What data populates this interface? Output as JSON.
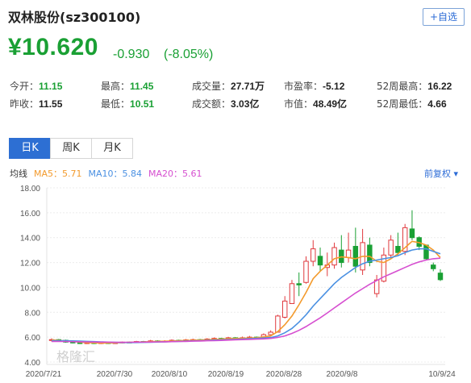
{
  "header": {
    "title": "双林股份(sz300100)",
    "watch_button": "+自选",
    "price": "¥10.620",
    "change": "-0.930",
    "change_pct": "(-8.05%)"
  },
  "stats": [
    {
      "label": "今开：",
      "value": "11.15",
      "tone": "green"
    },
    {
      "label": "最高：",
      "value": "11.45",
      "tone": "green"
    },
    {
      "label": "成交量：",
      "value": "27.71万",
      "tone": "dark"
    },
    {
      "label": "市盈率：",
      "value": "-5.12",
      "tone": "dark"
    },
    {
      "label": "52周最高：",
      "value": "16.22",
      "tone": "dark"
    },
    {
      "label": "昨收：",
      "value": "11.55",
      "tone": "dark"
    },
    {
      "label": "最低：",
      "value": "10.51",
      "tone": "green"
    },
    {
      "label": "成交额：",
      "value": "3.03亿",
      "tone": "dark"
    },
    {
      "label": "市值：",
      "value": "48.49亿",
      "tone": "dark"
    },
    {
      "label": "52周最低：",
      "value": "4.66",
      "tone": "dark"
    }
  ],
  "tabs": [
    "日K",
    "周K",
    "月K"
  ],
  "active_tab": 0,
  "ma_legend": {
    "label": "均线",
    "items": [
      {
        "text": "MA5：5.71",
        "color": "#f39a2c"
      },
      {
        "text": "MA10：5.84",
        "color": "#4a90e2"
      },
      {
        "text": "MA20：5.61",
        "color": "#d64fd0"
      }
    ]
  },
  "adjust_button": "前复权 ▾",
  "watermark": "格隆汇",
  "chart_data": {
    "type": "candlestick",
    "ylim": [
      4,
      18
    ],
    "y_ticks": [
      "18.00",
      "16.00",
      "14.00",
      "12.00",
      "10.00",
      "8.00",
      "6.00",
      "4.00"
    ],
    "x_ticks": [
      "2020/7/21",
      "2020/7/30",
      "2020/8/10",
      "2020/8/19",
      "2020/8/28",
      "2020/9/8",
      "10/9/24"
    ],
    "colors": {
      "up": "#e0393e",
      "down": "#1aa034",
      "ma5": "#f39a2c",
      "ma10": "#4a90e2",
      "ma20": "#d64fd0"
    },
    "candles": [
      {
        "o": 5.75,
        "c": 5.8,
        "h": 5.9,
        "l": 5.65
      },
      {
        "o": 5.8,
        "c": 5.75,
        "h": 5.85,
        "l": 5.7
      },
      {
        "o": 5.75,
        "c": 5.6,
        "h": 5.8,
        "l": 5.55
      },
      {
        "o": 5.6,
        "c": 5.55,
        "h": 5.65,
        "l": 5.5
      },
      {
        "o": 5.55,
        "c": 5.5,
        "h": 5.6,
        "l": 5.45
      },
      {
        "o": 5.5,
        "c": 5.55,
        "h": 5.6,
        "l": 5.45
      },
      {
        "o": 5.55,
        "c": 5.5,
        "h": 5.6,
        "l": 5.45
      },
      {
        "o": 5.5,
        "c": 5.55,
        "h": 5.6,
        "l": 5.45
      },
      {
        "o": 5.55,
        "c": 5.5,
        "h": 5.58,
        "l": 5.45
      },
      {
        "o": 5.5,
        "c": 5.55,
        "h": 5.6,
        "l": 5.48
      },
      {
        "o": 5.55,
        "c": 5.6,
        "h": 5.65,
        "l": 5.5
      },
      {
        "o": 5.6,
        "c": 5.58,
        "h": 5.65,
        "l": 5.52
      },
      {
        "o": 5.58,
        "c": 5.65,
        "h": 5.7,
        "l": 5.55
      },
      {
        "o": 5.65,
        "c": 5.6,
        "h": 5.7,
        "l": 5.55
      },
      {
        "o": 5.6,
        "c": 5.7,
        "h": 5.78,
        "l": 5.58
      },
      {
        "o": 5.7,
        "c": 5.65,
        "h": 5.75,
        "l": 5.6
      },
      {
        "o": 5.65,
        "c": 5.68,
        "h": 5.75,
        "l": 5.6
      },
      {
        "o": 5.68,
        "c": 5.75,
        "h": 5.82,
        "l": 5.62
      },
      {
        "o": 5.75,
        "c": 5.7,
        "h": 5.8,
        "l": 5.65
      },
      {
        "o": 5.7,
        "c": 5.78,
        "h": 5.85,
        "l": 5.66
      },
      {
        "o": 5.78,
        "c": 5.8,
        "h": 5.88,
        "l": 5.72
      },
      {
        "o": 5.8,
        "c": 5.75,
        "h": 5.86,
        "l": 5.7
      },
      {
        "o": 5.75,
        "c": 5.85,
        "h": 5.92,
        "l": 5.72
      },
      {
        "o": 5.85,
        "c": 5.9,
        "h": 5.98,
        "l": 5.8
      },
      {
        "o": 5.9,
        "c": 5.85,
        "h": 5.95,
        "l": 5.8
      },
      {
        "o": 5.85,
        "c": 5.95,
        "h": 6.02,
        "l": 5.82
      },
      {
        "o": 5.95,
        "c": 5.9,
        "h": 6.0,
        "l": 5.85
      },
      {
        "o": 5.9,
        "c": 5.95,
        "h": 6.05,
        "l": 5.86
      },
      {
        "o": 5.95,
        "c": 6.0,
        "h": 6.1,
        "l": 5.9
      },
      {
        "o": 6.0,
        "c": 5.95,
        "h": 6.05,
        "l": 5.9
      },
      {
        "o": 5.95,
        "c": 6.2,
        "h": 6.3,
        "l": 5.92
      },
      {
        "o": 6.2,
        "c": 6.4,
        "h": 6.55,
        "l": 6.15
      },
      {
        "o": 6.4,
        "c": 7.7,
        "h": 7.8,
        "l": 6.4
      },
      {
        "o": 7.6,
        "c": 8.9,
        "h": 9.3,
        "l": 7.5
      },
      {
        "o": 8.7,
        "c": 10.3,
        "h": 10.6,
        "l": 8.7
      },
      {
        "o": 10.3,
        "c": 10.2,
        "h": 11.2,
        "l": 9.3
      },
      {
        "o": 10.4,
        "c": 12.1,
        "h": 12.5,
        "l": 10.3
      },
      {
        "o": 12.1,
        "c": 13.1,
        "h": 13.8,
        "l": 11.7
      },
      {
        "o": 12.5,
        "c": 11.8,
        "h": 13.2,
        "l": 11.3
      },
      {
        "o": 11.6,
        "c": 11.8,
        "h": 12.8,
        "l": 10.9
      },
      {
        "o": 11.8,
        "c": 13.2,
        "h": 13.6,
        "l": 11.5
      },
      {
        "o": 13.0,
        "c": 12.0,
        "h": 14.2,
        "l": 11.6
      },
      {
        "o": 12.4,
        "c": 13.0,
        "h": 14.4,
        "l": 12.0
      },
      {
        "o": 13.3,
        "c": 11.7,
        "h": 14.8,
        "l": 11.2
      },
      {
        "o": 11.4,
        "c": 13.6,
        "h": 14.7,
        "l": 11.0
      },
      {
        "o": 13.4,
        "c": 12.0,
        "h": 14.0,
        "l": 11.7
      },
      {
        "o": 9.5,
        "c": 10.6,
        "h": 11.0,
        "l": 9.2
      },
      {
        "o": 10.5,
        "c": 12.6,
        "h": 13.2,
        "l": 10.4
      },
      {
        "o": 12.6,
        "c": 13.8,
        "h": 14.2,
        "l": 12.4
      },
      {
        "o": 13.3,
        "c": 12.8,
        "h": 14.4,
        "l": 12.6
      },
      {
        "o": 12.9,
        "c": 14.8,
        "h": 15.1,
        "l": 12.6
      },
      {
        "o": 14.7,
        "c": 14.0,
        "h": 16.2,
        "l": 13.8
      },
      {
        "o": 14.0,
        "c": 13.3,
        "h": 14.1,
        "l": 13.0
      },
      {
        "o": 13.4,
        "c": 12.3,
        "h": 13.4,
        "l": 12.2
      },
      {
        "o": 11.8,
        "c": 11.5,
        "h": 12.0,
        "l": 11.3
      },
      {
        "o": 11.15,
        "c": 10.62,
        "h": 11.45,
        "l": 10.51
      }
    ],
    "ma5": [
      5.78,
      5.74,
      5.7,
      5.65,
      5.6,
      5.56,
      5.54,
      5.53,
      5.53,
      5.54,
      5.56,
      5.58,
      5.6,
      5.62,
      5.64,
      5.66,
      5.67,
      5.69,
      5.71,
      5.73,
      5.75,
      5.77,
      5.79,
      5.82,
      5.84,
      5.87,
      5.89,
      5.91,
      5.93,
      5.95,
      6.02,
      6.1,
      6.45,
      7.0,
      7.7,
      8.6,
      9.6,
      10.7,
      11.3,
      11.8,
      12.3,
      12.45,
      12.4,
      12.3,
      12.5,
      12.5,
      12.1,
      12.0,
      12.3,
      12.7,
      13.2,
      13.7,
      13.6,
      13.4,
      13.0,
      12.4
    ],
    "ma10": [
      5.72,
      5.72,
      5.71,
      5.7,
      5.68,
      5.66,
      5.64,
      5.62,
      5.6,
      5.58,
      5.57,
      5.57,
      5.57,
      5.58,
      5.59,
      5.61,
      5.62,
      5.64,
      5.66,
      5.68,
      5.7,
      5.72,
      5.74,
      5.76,
      5.78,
      5.8,
      5.82,
      5.85,
      5.87,
      5.9,
      5.93,
      5.97,
      6.1,
      6.35,
      6.7,
      7.2,
      7.8,
      8.5,
      9.1,
      9.7,
      10.3,
      10.8,
      11.2,
      11.6,
      11.9,
      12.1,
      12.2,
      12.3,
      12.4,
      12.55,
      12.8,
      13.0,
      13.1,
      13.1,
      12.9,
      12.7
    ],
    "ma20": [
      5.65,
      5.65,
      5.65,
      5.64,
      5.63,
      5.62,
      5.61,
      5.6,
      5.6,
      5.59,
      5.59,
      5.59,
      5.6,
      5.6,
      5.61,
      5.62,
      5.63,
      5.64,
      5.65,
      5.66,
      5.68,
      5.69,
      5.71,
      5.72,
      5.74,
      5.76,
      5.78,
      5.8,
      5.82,
      5.84,
      5.86,
      5.9,
      5.98,
      6.1,
      6.3,
      6.55,
      6.85,
      7.2,
      7.55,
      7.95,
      8.35,
      8.75,
      9.15,
      9.55,
      9.9,
      10.25,
      10.55,
      10.85,
      11.1,
      11.35,
      11.6,
      11.85,
      12.05,
      12.2,
      12.3,
      12.35
    ]
  }
}
